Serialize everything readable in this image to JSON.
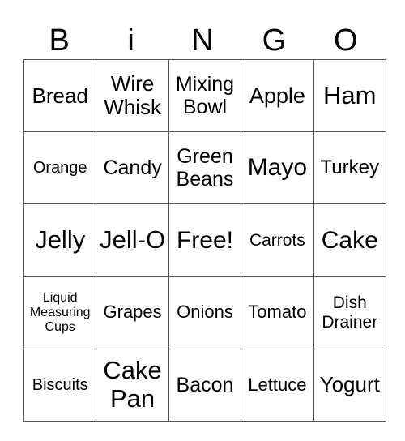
{
  "header": {
    "letters": [
      "B",
      "i",
      "N",
      "G",
      "O"
    ]
  },
  "board": {
    "rows": [
      [
        "Bread",
        "Wire Whisk",
        "Mixing Bowl",
        "Apple",
        "Ham"
      ],
      [
        "Orange",
        "Candy",
        "Green Beans",
        "Mayo",
        "Turkey"
      ],
      [
        "Jelly",
        "Jell-O",
        "Free!",
        "Carrots",
        "Cake"
      ],
      [
        "Liquid Measuring Cups",
        "Grapes",
        "Onions",
        "Tomato",
        "Dish Drainer"
      ],
      [
        "Biscuits",
        "Cake Pan",
        "Bacon",
        "Lettuce",
        "Yogurt"
      ]
    ],
    "free_space": "Free!"
  }
}
